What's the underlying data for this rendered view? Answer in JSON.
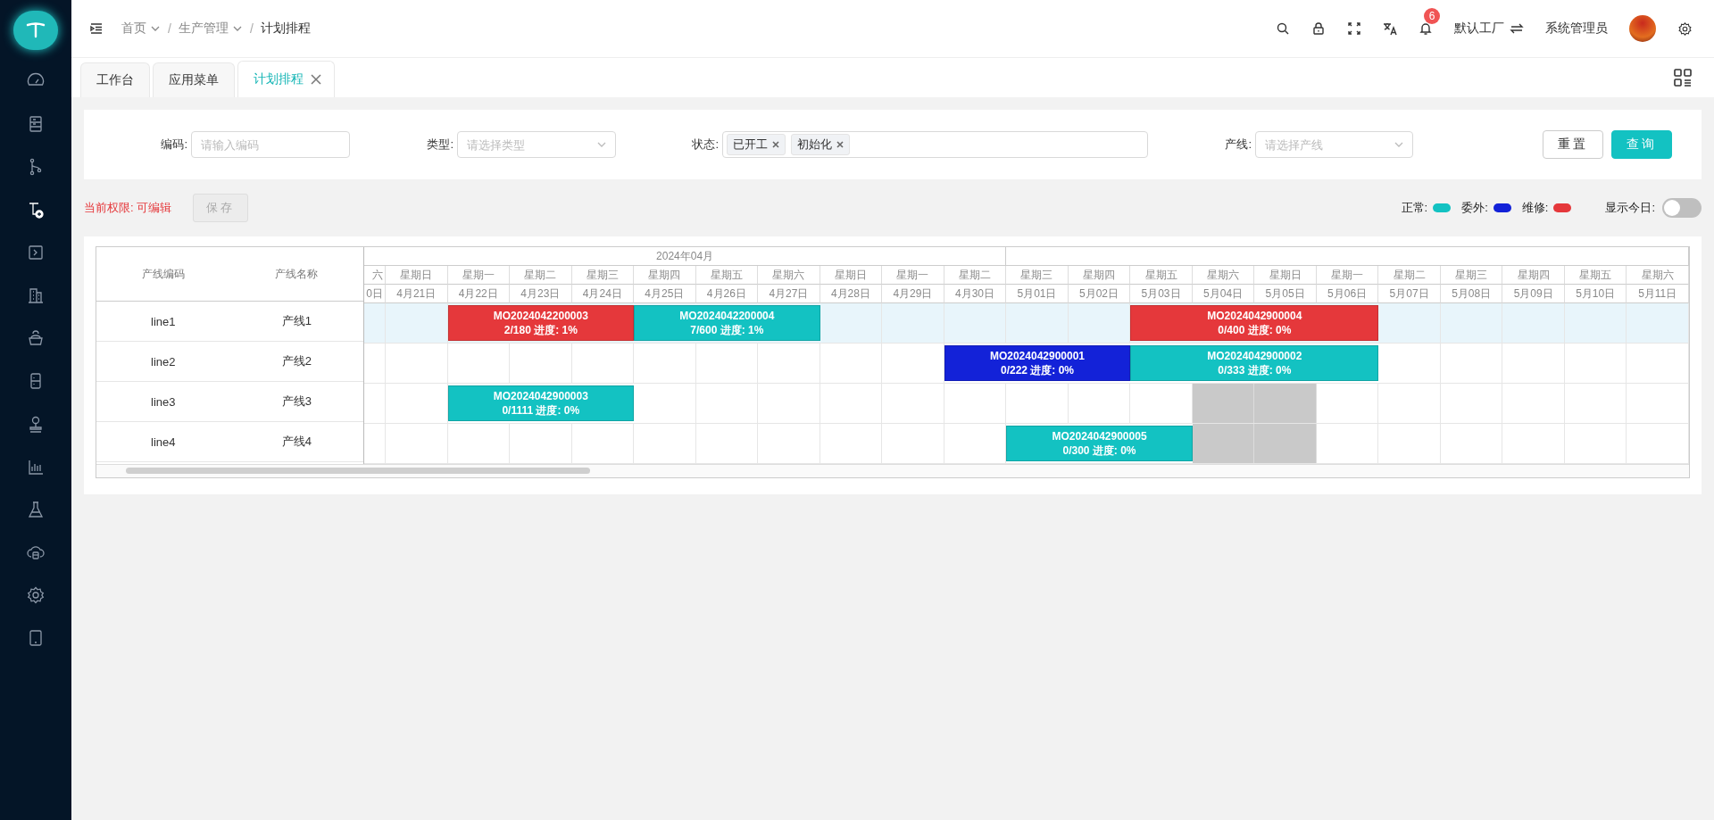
{
  "sidebar": {
    "items": [
      {
        "selected": false
      },
      {
        "selected": false
      },
      {
        "selected": false
      },
      {
        "selected": true
      },
      {
        "selected": false
      },
      {
        "selected": false
      },
      {
        "selected": false
      },
      {
        "selected": false
      },
      {
        "selected": false
      },
      {
        "selected": false
      },
      {
        "selected": false
      },
      {
        "selected": false
      },
      {
        "selected": false
      },
      {
        "selected": false
      }
    ]
  },
  "breadcrumb": [
    {
      "label": "首页",
      "dropdown": true
    },
    {
      "separator": "/",
      "label": "生产管理",
      "dropdown": true
    },
    {
      "separator": "/",
      "label": "计划排程",
      "dropdown": false
    }
  ],
  "header": {
    "notifications": "6",
    "factory": "默认工厂",
    "user": "系统管理员"
  },
  "tabs": [
    {
      "label": "工作台",
      "selected": false,
      "closable": false
    },
    {
      "label": "应用菜单",
      "selected": false,
      "closable": false
    },
    {
      "label": "计划排程",
      "selected": true,
      "closable": true
    }
  ],
  "filters": [
    {
      "kind": "input",
      "label": "编码:",
      "placeholder": "请输入编码"
    },
    {
      "kind": "select",
      "label": "类型:",
      "placeholder": "请选择类型"
    },
    {
      "kind": "tags",
      "label": "状态:",
      "tags": [
        "已开工",
        "初始化"
      ]
    },
    {
      "kind": "select",
      "label": "产线:",
      "placeholder": "请选择产线"
    }
  ],
  "buttons": [
    {
      "label": "重置",
      "kind": "default"
    },
    {
      "label": "查询",
      "kind": "primary"
    }
  ],
  "permission": "当前权限: 可编辑",
  "save": {
    "label": "保存",
    "disabled": true
  },
  "legend": [
    {
      "label": "正常:",
      "color": "#13c2c2"
    },
    {
      "label": "委外:",
      "color": "#1322d8"
    },
    {
      "label": "维修:",
      "color": "#e5383b"
    }
  ],
  "show_today": {
    "label": "显示今日:",
    "on": false
  },
  "gantt": {
    "columns": [
      "产线编码",
      "产线名称"
    ],
    "months": [
      {
        "label": "2024年04月",
        "days": [
          {
            "weekday": "六",
            "date": "0日"
          },
          {
            "weekday": "星期日",
            "date": "4月21日"
          },
          {
            "weekday": "星期一",
            "date": "4月22日"
          },
          {
            "weekday": "星期二",
            "date": "4月23日"
          },
          {
            "weekday": "星期三",
            "date": "4月24日"
          },
          {
            "weekday": "星期四",
            "date": "4月25日"
          },
          {
            "weekday": "星期五",
            "date": "4月26日"
          },
          {
            "weekday": "星期六",
            "date": "4月27日"
          },
          {
            "weekday": "星期日",
            "date": "4月28日"
          },
          {
            "weekday": "星期一",
            "date": "4月29日"
          },
          {
            "weekday": "星期二",
            "date": "4月30日"
          }
        ]
      },
      {
        "days": [
          {
            "weekday": "星期三",
            "date": "5月01日"
          },
          {
            "weekday": "星期四",
            "date": "5月02日"
          },
          {
            "weekday": "星期五",
            "date": "5月03日"
          },
          {
            "weekday": "星期六",
            "date": "5月04日"
          },
          {
            "weekday": "星期日",
            "date": "5月05日"
          },
          {
            "weekday": "星期一",
            "date": "5月06日"
          },
          {
            "weekday": "星期二",
            "date": "5月07日"
          },
          {
            "weekday": "星期三",
            "date": "5月08日"
          },
          {
            "weekday": "星期四",
            "date": "5月09日"
          },
          {
            "weekday": "星期五",
            "date": "5月10日"
          },
          {
            "weekday": "星期六",
            "date": "5月11日"
          }
        ]
      }
    ],
    "rows": [
      {
        "code": "line1",
        "name": "产线1",
        "selected": true,
        "cells": [
          {
            "kind": "empty"
          },
          {
            "kind": "empty"
          },
          {
            "kind": "order",
            "order": "MO2024042200003",
            "progress": "2/180 进度: 1%",
            "color": "#e5383b"
          },
          {
            "kind": "span"
          },
          {
            "kind": "span"
          },
          {
            "kind": "order",
            "order": "MO2024042200004",
            "progress": "7/600 进度: 1%",
            "color": "#13c2c2"
          },
          {
            "kind": "span"
          },
          {
            "kind": "span"
          },
          {
            "kind": "empty"
          },
          {
            "kind": "empty"
          },
          {
            "kind": "empty"
          },
          {
            "kind": "empty"
          },
          {
            "kind": "empty"
          },
          {
            "kind": "order",
            "order": "MO2024042900004",
            "progress": "0/400 进度: 0%",
            "color": "#e5383b"
          },
          {
            "kind": "span"
          },
          {
            "kind": "span"
          },
          {
            "kind": "span"
          },
          {
            "kind": "empty"
          },
          {
            "kind": "empty"
          },
          {
            "kind": "empty"
          },
          {
            "kind": "empty"
          },
          {
            "kind": "empty"
          }
        ]
      },
      {
        "code": "line2",
        "name": "产线2",
        "selected": false,
        "cells": [
          {
            "kind": "empty"
          },
          {
            "kind": "empty"
          },
          {
            "kind": "empty"
          },
          {
            "kind": "empty"
          },
          {
            "kind": "empty"
          },
          {
            "kind": "empty"
          },
          {
            "kind": "empty"
          },
          {
            "kind": "empty"
          },
          {
            "kind": "empty"
          },
          {
            "kind": "empty"
          },
          {
            "kind": "order",
            "order": "MO2024042900001",
            "progress": "0/222 进度: 0%",
            "color": "#1322d8"
          },
          {
            "kind": "span"
          },
          {
            "kind": "span"
          },
          {
            "kind": "order",
            "order": "MO2024042900002",
            "progress": "0/333 进度: 0%",
            "color": "#13c2c2"
          },
          {
            "kind": "span"
          },
          {
            "kind": "span"
          },
          {
            "kind": "span"
          },
          {
            "kind": "empty"
          },
          {
            "kind": "empty"
          },
          {
            "kind": "empty"
          },
          {
            "kind": "empty"
          },
          {
            "kind": "empty"
          }
        ]
      },
      {
        "code": "line3",
        "name": "产线3",
        "selected": false,
        "cells": [
          {
            "kind": "empty"
          },
          {
            "kind": "empty"
          },
          {
            "kind": "order",
            "order": "MO2024042900003",
            "progress": "0/1111 进度: 0%",
            "color": "#13c2c2"
          },
          {
            "kind": "span"
          },
          {
            "kind": "span"
          },
          {
            "kind": "empty"
          },
          {
            "kind": "empty"
          },
          {
            "kind": "empty"
          },
          {
            "kind": "empty"
          },
          {
            "kind": "empty"
          },
          {
            "kind": "empty"
          },
          {
            "kind": "empty"
          },
          {
            "kind": "empty"
          },
          {
            "kind": "empty"
          },
          {
            "kind": "blocked"
          },
          {
            "kind": "blocked"
          },
          {
            "kind": "empty"
          },
          {
            "kind": "empty"
          },
          {
            "kind": "empty"
          },
          {
            "kind": "empty"
          },
          {
            "kind": "empty"
          },
          {
            "kind": "empty"
          }
        ]
      },
      {
        "code": "line4",
        "name": "产线4",
        "selected": false,
        "cells": [
          {
            "kind": "empty"
          },
          {
            "kind": "empty"
          },
          {
            "kind": "empty"
          },
          {
            "kind": "empty"
          },
          {
            "kind": "empty"
          },
          {
            "kind": "empty"
          },
          {
            "kind": "empty"
          },
          {
            "kind": "empty"
          },
          {
            "kind": "empty"
          },
          {
            "kind": "empty"
          },
          {
            "kind": "empty"
          },
          {
            "kind": "order",
            "order": "MO2024042900005",
            "progress": "0/300 进度: 0%",
            "color": "#13c2c2"
          },
          {
            "kind": "span"
          },
          {
            "kind": "span"
          },
          {
            "kind": "blocked"
          },
          {
            "kind": "blocked"
          },
          {
            "kind": "empty"
          },
          {
            "kind": "empty"
          },
          {
            "kind": "empty"
          },
          {
            "kind": "empty"
          },
          {
            "kind": "empty"
          },
          {
            "kind": "empty"
          }
        ]
      }
    ]
  }
}
